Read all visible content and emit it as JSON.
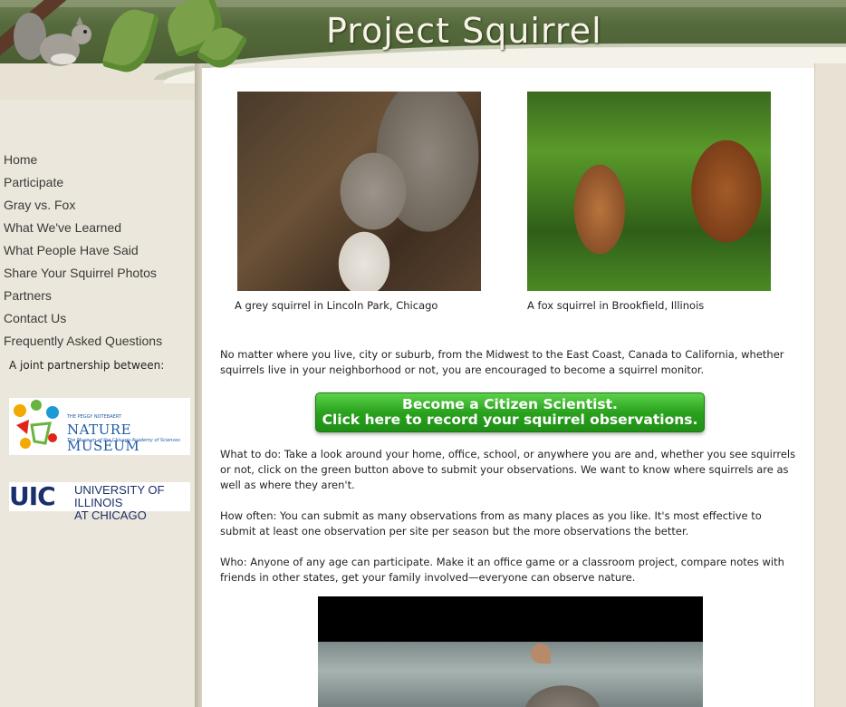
{
  "header": {
    "title": "Project Squirrel"
  },
  "nav": {
    "items": [
      "Home",
      "Participate",
      "Gray vs. Fox",
      "What We've Learned",
      "What People Have Said",
      "Share Your Squirrel Photos",
      "Partners",
      "Contact Us",
      "Frequently Asked Questions"
    ]
  },
  "partners": {
    "label": "A joint partnership between:",
    "nature_museum": {
      "small": "THE PEGGY NOTEBAERT",
      "name": "NATURE MUSEUM",
      "sub": "The Museum of the Chicago Academy of Sciences"
    },
    "uic": {
      "abbr": "UIC",
      "line1": "UNIVERSITY OF ILLINOIS",
      "line2": "AT CHICAGO"
    }
  },
  "photos": {
    "grey_caption": "A grey squirrel in Lincoln Park, Chicago",
    "fox_caption": "A fox squirrel in Brookfield, Illinois"
  },
  "intro": "No matter where you live, city or suburb, from the Midwest to the East Coast, Canada to California, whether squirrels live in your neighborhood or not, you are encouraged to become a squirrel monitor.",
  "cta": {
    "line1": "Become a Citizen Scientist.",
    "line2": "Click here to record your squirrel observations."
  },
  "what_to_do": "What to do:  Take a look around your home, office, school, or anywhere you are and, whether you see squirrels or not, click on the green button above to submit your observations.  We want to know where squirrels are as well as where they aren't.",
  "how_often": "How often:  You can submit as many observations from as many places as you like.  It's most effective to submit at least one observation per site per season but the more observations the better.",
  "who": "Who:  Anyone of any age can participate.  Make it an office game or a classroom project, compare notes with friends in other states, get your family involved—everyone can observe nature."
}
